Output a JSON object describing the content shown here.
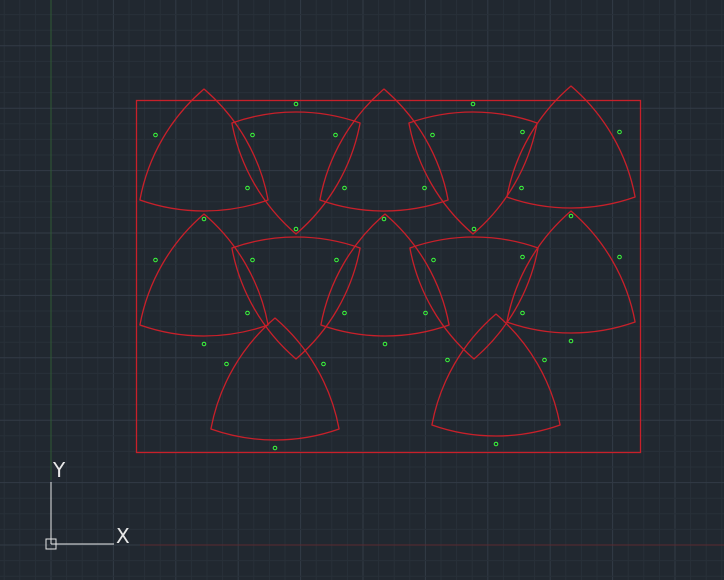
{
  "ucs": {
    "x_label": "X",
    "y_label": "Y"
  },
  "colors": {
    "background": "#212830",
    "grid_minor": "#283039",
    "grid_major": "#323b46",
    "y_axis": "#2f5a34",
    "x_axis": "#5a2a30",
    "shape": "#c8202a",
    "marker": "#3cff3c",
    "ucs_icon": "#e8e8e8"
  },
  "drawing": {
    "outline": "rectangle",
    "parts": "rounded-triangle",
    "part_count": 12,
    "markers_per_part": 3
  }
}
